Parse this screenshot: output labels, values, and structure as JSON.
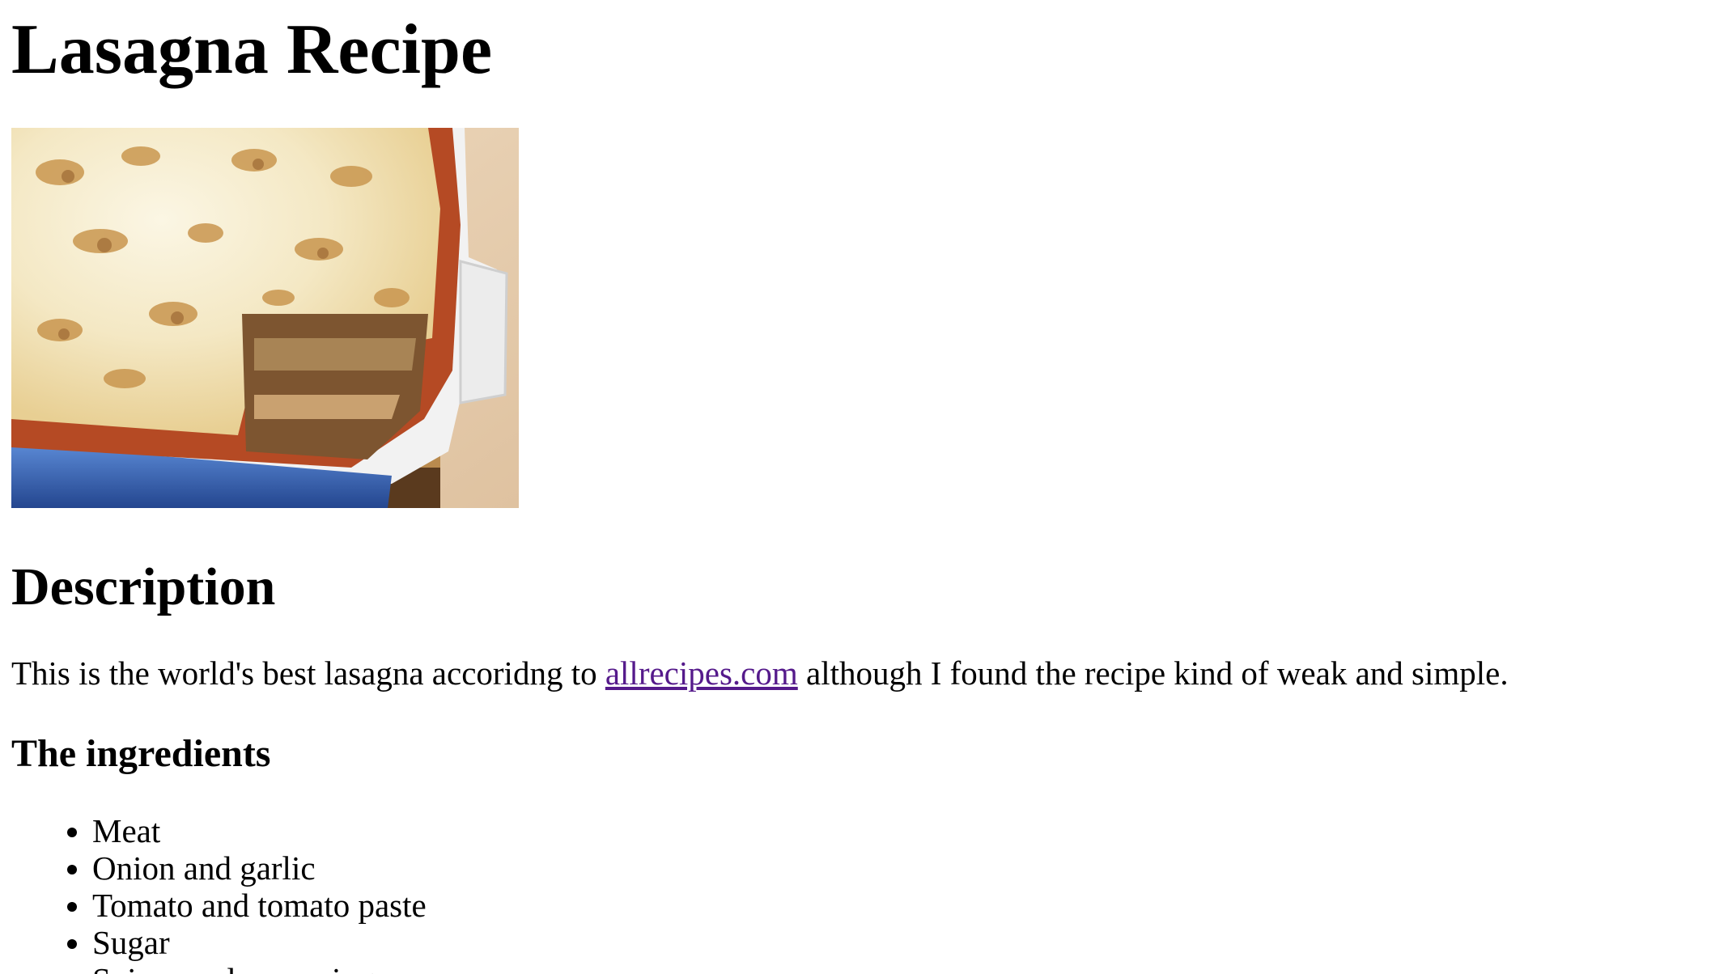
{
  "page": {
    "title": "Lasagna Recipe",
    "image_alt": "lasagna-photo"
  },
  "description": {
    "heading": "Description",
    "text_before": "This is the world's best lasagna accoridng to ",
    "link_text": "allrecipes.com",
    "text_after": " although I found the recipe kind of weak and simple."
  },
  "ingredients": {
    "heading": "The ingredients",
    "items": [
      "Meat",
      "Onion and garlic",
      "Tomato and tomato paste",
      "Sugar",
      "Spices and seasonings"
    ]
  },
  "colors": {
    "link_visited": "#551a8b",
    "text": "#000000",
    "background": "#ffffff"
  }
}
